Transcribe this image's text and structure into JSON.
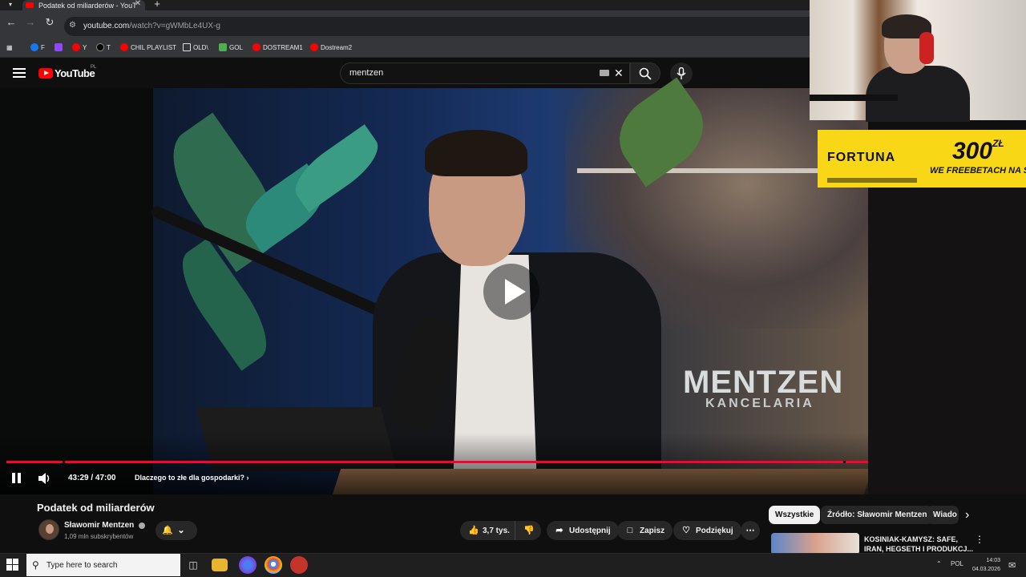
{
  "browser": {
    "tab_title": "Podatek od miliarderów - YouT",
    "url_host": "youtube.com",
    "url_path": "/watch?v=gWMbLe4UX-g",
    "bookmarks": [
      "F",
      "Y",
      "T",
      "CHIL PLAYLIST",
      "OLD\\",
      "GOL",
      "DOSTREAM1",
      "Dostream2"
    ]
  },
  "youtube": {
    "logo": "YouTube",
    "region": "PL",
    "search_value": "mentzen"
  },
  "video": {
    "overlay_logo_big": "MENTZEN",
    "overlay_logo_small": "KANCELARIA",
    "time_current": "43:29",
    "time_separator": " / ",
    "time_total": "47:00",
    "progress_fraction": 0.925,
    "chapter_title": "Dlaczego to złe dla gospodarki?",
    "accent": "#ff0033"
  },
  "meta": {
    "title": "Podatek od miliarderów",
    "channel": "Sławomir Mentzen",
    "subscribers": "1,09 mln subskrybentów",
    "likes": "3,7 tys.",
    "share": "Udostępnij",
    "save": "Zapisz",
    "thanks": "Podziękuj"
  },
  "chips": [
    "Wszystkie",
    "Źródło: Sławomir Mentzen",
    "Wiado"
  ],
  "recommendation": {
    "title_line1": "KOSINIAK-KAMYSZ: SAFE,",
    "title_line2": "IRAN, HEGSETH I PRODUKCJ..."
  },
  "ad": {
    "brand": "FORTUNA",
    "amount": "300",
    "currency": "ZŁ",
    "sub": "WE FREEBETACH NA STAR"
  },
  "taskbar": {
    "search_placeholder": "Type here to search",
    "lang": "POL",
    "time": "14:03",
    "date": "04.03.2026"
  }
}
